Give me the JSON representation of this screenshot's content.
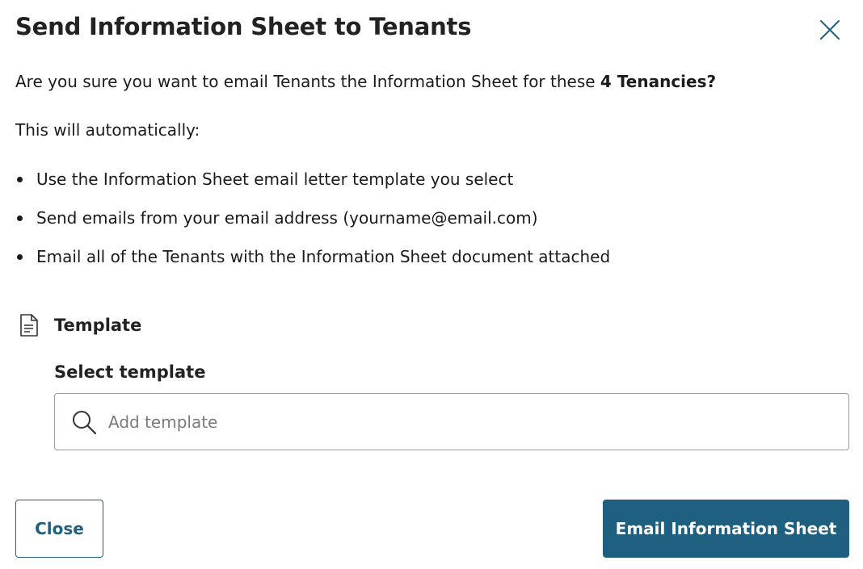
{
  "dialog": {
    "title": "Send Information Sheet to Tenants",
    "close_icon": "close-icon",
    "confirm_prefix": "Are you sure you want to email Tenants the Information Sheet for these ",
    "confirm_bold": "4 Tenancies?",
    "auto_intro": "This will automatically:",
    "bullets": [
      "Use the Information Sheet email letter template you select",
      "Send emails from your email address (yourname@email.com)",
      "Email all of the Tenants with the Information Sheet document attached"
    ]
  },
  "template_section": {
    "icon": "document-icon",
    "title": "Template",
    "field_label": "Select template",
    "search_icon": "search-icon",
    "placeholder": "Add template",
    "value": ""
  },
  "footer": {
    "close_label": "Close",
    "primary_label": "Email Information Sheet"
  },
  "colors": {
    "accent": "#1f5f80",
    "text": "#1b1b1b",
    "border": "#9a9a9a"
  }
}
